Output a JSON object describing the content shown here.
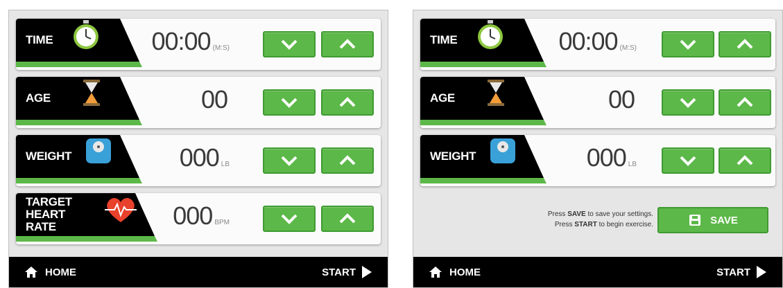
{
  "left_panel": {
    "rows": [
      {
        "label": "TIME",
        "icon": "stopwatch-icon",
        "value": "00:00",
        "unit": "(M:S)"
      },
      {
        "label": "AGE",
        "icon": "hourglass-icon",
        "value": "00",
        "unit": ""
      },
      {
        "label": "WEIGHT",
        "icon": "scale-icon",
        "value": "000",
        "unit": "LB"
      },
      {
        "label_line1": "TARGET",
        "label_line2": "HEART RATE",
        "icon": "heart-rate-icon",
        "value": "000",
        "unit": "BPM"
      }
    ],
    "footer": {
      "home_label": "HOME",
      "start_label": "START"
    }
  },
  "right_panel": {
    "rows": [
      {
        "label": "TIME",
        "icon": "stopwatch-icon",
        "value": "00:00",
        "unit": "(M:S)"
      },
      {
        "label": "AGE",
        "icon": "hourglass-icon",
        "value": "00",
        "unit": ""
      },
      {
        "label": "WEIGHT",
        "icon": "scale-icon",
        "value": "000",
        "unit": "LB"
      }
    ],
    "save_hint": {
      "line1_pre": "Press ",
      "line1_bold": "SAVE",
      "line1_post": " to save your settings.",
      "line2_pre": "Press ",
      "line2_bold": "START",
      "line2_post": " to begin exercise."
    },
    "save_label": "SAVE",
    "footer": {
      "home_label": "HOME",
      "start_label": "START"
    }
  },
  "colors": {
    "accent_green": "#5cb848",
    "label_black": "#000000",
    "background": "#e6e6e6"
  }
}
